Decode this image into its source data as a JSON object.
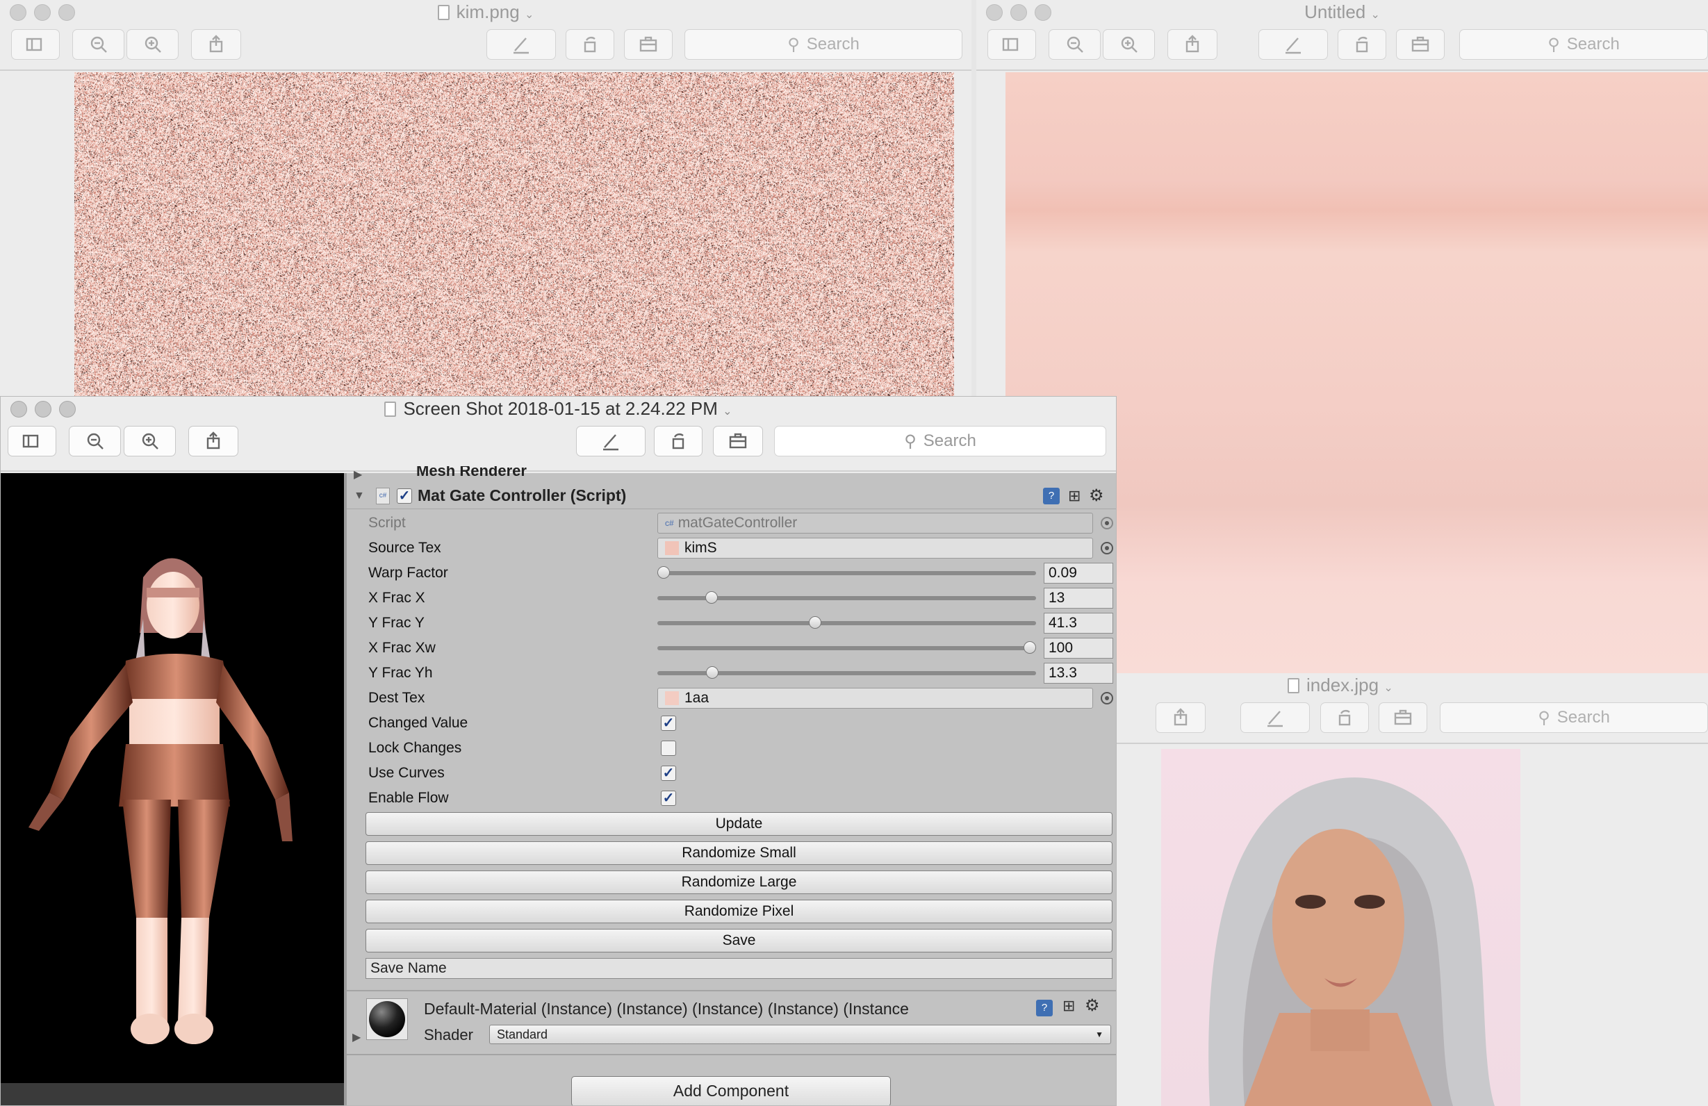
{
  "windows": {
    "kim": {
      "title": "kim.png",
      "search": "Search"
    },
    "untitled": {
      "title": "Untitled",
      "search": "Search"
    },
    "index": {
      "title": "index.jpg",
      "search": "Search"
    },
    "screenshot": {
      "title": "Screen Shot 2018-01-15 at 2.24.22 PM",
      "search": "Search"
    }
  },
  "inspector": {
    "mesh_renderer": "Mesh Renderer",
    "component_title": "Mat Gate Controller (Script)",
    "properties": {
      "script": {
        "label": "Script",
        "value": "matGateController"
      },
      "source_tex": {
        "label": "Source Tex",
        "value": "kimS"
      },
      "warp_factor": {
        "label": "Warp Factor",
        "value": "0.09",
        "fill": 0.0
      },
      "x_frac_x": {
        "label": "X Frac X",
        "value": "13",
        "fill": 0.13
      },
      "y_frac_y": {
        "label": "Y Frac Y",
        "value": "41.3",
        "fill": 0.413
      },
      "x_frac_xw": {
        "label": "X Frac Xw",
        "value": "100",
        "fill": 1.0
      },
      "y_frac_yh": {
        "label": "Y Frac Yh",
        "value": "13.3",
        "fill": 0.133
      },
      "dest_tex": {
        "label": "Dest Tex",
        "value": "1aa"
      },
      "changed_value": {
        "label": "Changed Value",
        "checked": true
      },
      "lock_changes": {
        "label": "Lock Changes",
        "checked": false
      },
      "use_curves": {
        "label": "Use Curves",
        "checked": true
      },
      "enable_flow": {
        "label": "Enable Flow",
        "checked": true
      }
    },
    "buttons": {
      "update": "Update",
      "randomize_small": "Randomize Small",
      "randomize_large": "Randomize Large",
      "randomize_pixel": "Randomize Pixel",
      "save": "Save"
    },
    "save_name": "Save Name",
    "material": {
      "name": "Default-Material (Instance) (Instance) (Instance) (Instance) (Instance",
      "shader_label": "Shader",
      "shader_value": "Standard"
    },
    "add_component": "Add Component"
  },
  "colors": {
    "inspector_bg": "#c2c2c2",
    "checkbox_tick": "#1d3f86",
    "noise_base": "#efc3b6",
    "viewport_bg": "#000000"
  }
}
